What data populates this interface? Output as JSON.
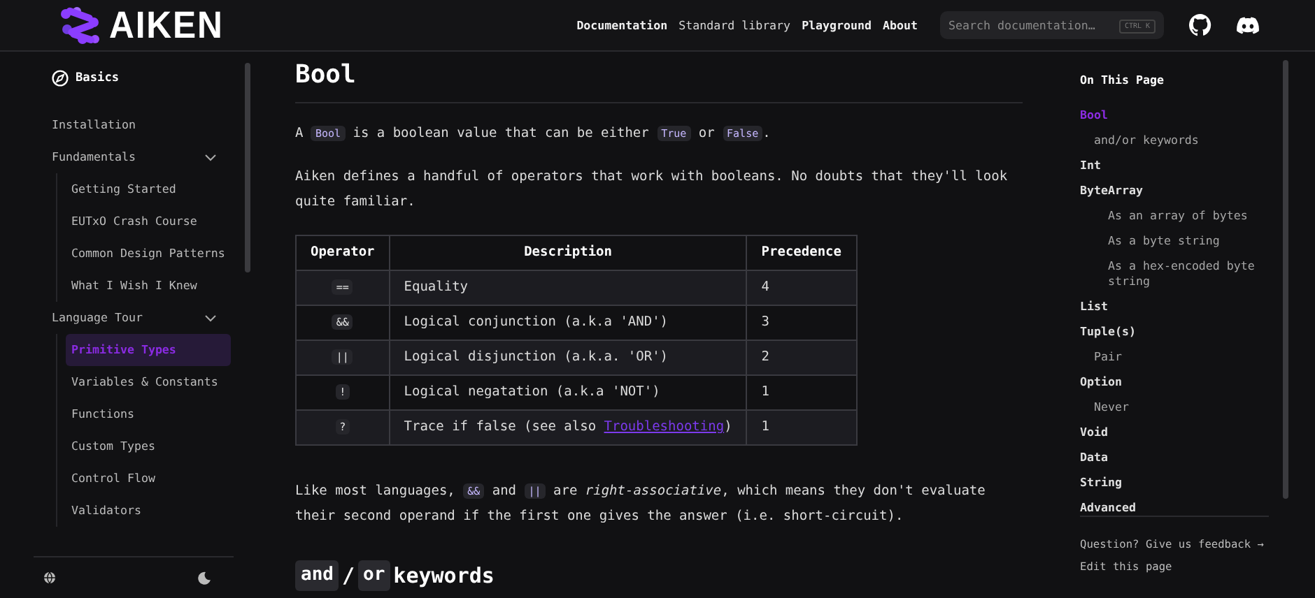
{
  "header": {
    "logo_text": "AIKEN",
    "nav": [
      {
        "label": "Documentation"
      },
      {
        "label": "Standard library"
      },
      {
        "label": "Playground"
      },
      {
        "label": "About"
      }
    ],
    "search": {
      "placeholder": "Search documentation…",
      "shortcut": "CTRL K"
    }
  },
  "sidebar": {
    "title": "Basics",
    "items": [
      {
        "label": "Installation",
        "kind": "link",
        "selected": false
      },
      {
        "label": "Fundamentals",
        "kind": "group",
        "expanded": true,
        "selected": false,
        "children": [
          {
            "label": "Getting Started",
            "selected": false
          },
          {
            "label": "EUTxO Crash Course",
            "selected": false
          },
          {
            "label": "Common Design Patterns",
            "selected": false
          },
          {
            "label": "What I Wish I Knew",
            "selected": false
          }
        ]
      },
      {
        "label": "Language Tour",
        "kind": "group",
        "expanded": true,
        "selected": false,
        "children": [
          {
            "label": "Primitive Types",
            "selected": true
          },
          {
            "label": "Variables & Constants",
            "selected": false
          },
          {
            "label": "Functions",
            "selected": false
          },
          {
            "label": "Custom Types",
            "selected": false
          },
          {
            "label": "Control Flow",
            "selected": false
          },
          {
            "label": "Validators",
            "selected": false
          }
        ]
      }
    ]
  },
  "content": {
    "title": "Bool",
    "intro": [
      {
        "kind": "text",
        "text": "A "
      },
      {
        "kind": "code",
        "text": "Bool"
      },
      {
        "kind": "text",
        "text": " is a boolean value that can be either "
      },
      {
        "kind": "code",
        "text": "True"
      },
      {
        "kind": "text",
        "text": " or "
      },
      {
        "kind": "code",
        "text": "False"
      },
      {
        "kind": "text",
        "text": "."
      }
    ],
    "paragraph": [
      {
        "kind": "text",
        "text": "Aiken defines a handful of operators that work with booleans. No doubts that they'll look quite familiar."
      }
    ],
    "table": {
      "columns": [
        "Operator",
        "Description",
        "Precedence"
      ],
      "rows": [
        {
          "operator": "==",
          "description": "Equality",
          "precedence": "4"
        },
        {
          "operator": "&&",
          "description": "Logical conjunction (a.k.a 'AND')",
          "precedence": "3"
        },
        {
          "operator": "||",
          "description": "Logical disjunction (a.k.a. 'OR')",
          "precedence": "2"
        },
        {
          "operator": "!",
          "description": "Logical negatation (a.k.a 'NOT')",
          "precedence": "1"
        },
        {
          "operator": "?",
          "description": "Trace if false (see also ",
          "link": "Troubleshooting",
          "description_after": ")",
          "precedence": "1"
        }
      ]
    },
    "paragraph_2": [
      {
        "kind": "text",
        "text": "Like most languages, "
      },
      {
        "kind": "code",
        "text": "&&"
      },
      {
        "kind": "text",
        "text": " and "
      },
      {
        "kind": "code",
        "text": "||"
      },
      {
        "kind": "text",
        "text": " are "
      },
      {
        "kind": "em",
        "text": "right-associative"
      },
      {
        "kind": "text",
        "text": ", which means they don't evaluate their second operand if the first one gives the answer (i.e. short-circuit)."
      }
    ],
    "subheading": [
      {
        "kind": "code",
        "text": "and"
      },
      {
        "kind": "text",
        "text": "/"
      },
      {
        "kind": "code",
        "text": "or"
      },
      {
        "kind": "text",
        "text": " keywords"
      }
    ]
  },
  "toc": {
    "title": "On This Page",
    "items": [
      {
        "label": "Bool",
        "selected": true,
        "children": [
          {
            "label": "and/or keywords",
            "selected": false
          }
        ]
      },
      {
        "label": "Int",
        "selected": false
      },
      {
        "label": "ByteArray",
        "selected": false,
        "children": [
          {
            "label": "As an array of bytes",
            "selected": false
          },
          {
            "label": "As a byte string",
            "selected": false
          },
          {
            "label": "As a hex-encoded byte string",
            "selected": false
          }
        ]
      },
      {
        "label": "List",
        "selected": false
      },
      {
        "label": "Tuple(s)",
        "selected": false,
        "children": [
          {
            "label": "Pair",
            "selected": false
          }
        ]
      },
      {
        "label": "Option",
        "selected": false,
        "children": [
          {
            "label": "Never",
            "selected": false
          }
        ]
      },
      {
        "label": "Void",
        "selected": false
      },
      {
        "label": "Data",
        "selected": false
      },
      {
        "label": "String",
        "selected": false
      },
      {
        "label": "Advanced",
        "selected": false
      }
    ],
    "feedback": "Question? Give us feedback →",
    "edit": "Edit this page"
  }
}
